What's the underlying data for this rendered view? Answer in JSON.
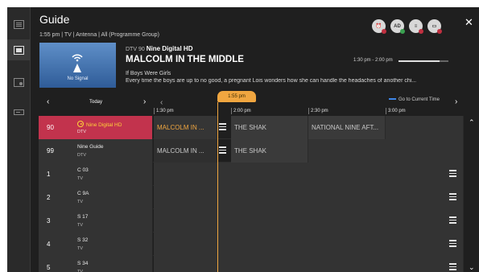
{
  "header": {
    "title": "Guide",
    "subtitle": "1:55 pm | TV | Antenna | All (Programme Group)",
    "icons": [
      {
        "name": "reminder-icon",
        "label": "⏰"
      },
      {
        "name": "audio-description-icon",
        "label": "AD"
      },
      {
        "name": "schedule-list-icon",
        "label": "≡"
      },
      {
        "name": "display-icon",
        "label": "▭"
      }
    ],
    "close_label": "✕"
  },
  "sidebar": {
    "items": [
      {
        "name": "sidebar-item-guide",
        "icon": "list-icon"
      },
      {
        "name": "sidebar-item-schedule",
        "icon": "calendar-icon"
      },
      {
        "name": "sidebar-item-recordings",
        "icon": "record-icon"
      },
      {
        "name": "sidebar-item-settings",
        "icon": "hdd-icon"
      }
    ]
  },
  "now_playing": {
    "thumbnail_text": "No Signal",
    "channel_number": "DTV 90",
    "channel_name": "Nine Digital HD",
    "program_title": "MALCOLM IN THE MIDDLE",
    "time_range": "1:30 pm - 2:00 pm",
    "progress": 0.83,
    "episode": "If Boys Were Girls",
    "description": "Every time the boys are up to no good, a pregnant Lois wonders how she can handle the headaches of another chi..."
  },
  "timeline": {
    "prev_label": "‹",
    "day_label": "Today",
    "next_day_label": "›",
    "prev_time_label": "‹",
    "next_time_label": "›",
    "current_time_badge": "1:55 pm",
    "goto_label": "Go to Current Time",
    "ticks": [
      "1:30 pm",
      "2:00 pm",
      "2:30 pm",
      "3:00 pm"
    ]
  },
  "channels": [
    {
      "num": "90",
      "name": "Nine Digital HD",
      "type": "DTV",
      "selected": true,
      "programs": [
        "MALCOLM IN ...",
        "THE SHAK",
        "NATIONAL NINE AFT..."
      ]
    },
    {
      "num": "99",
      "name": "Nine Guide",
      "type": "DTV",
      "selected": false,
      "programs": [
        "MALCOLM IN ...",
        "THE SHAK"
      ]
    },
    {
      "num": "1",
      "name": "C 03",
      "type": "TV",
      "programs": []
    },
    {
      "num": "2",
      "name": "C 9A",
      "type": "TV",
      "programs": []
    },
    {
      "num": "3",
      "name": "S 17",
      "type": "TV",
      "programs": []
    },
    {
      "num": "4",
      "name": "S 32",
      "type": "TV",
      "programs": []
    },
    {
      "num": "5",
      "name": "S 34",
      "type": "TV",
      "programs": []
    }
  ],
  "scroll": {
    "up": "⌃",
    "down": "⌄"
  },
  "colors": {
    "selected_row": "#c2334d",
    "now_marker": "#f0a640",
    "accent": "#3d86e8"
  }
}
